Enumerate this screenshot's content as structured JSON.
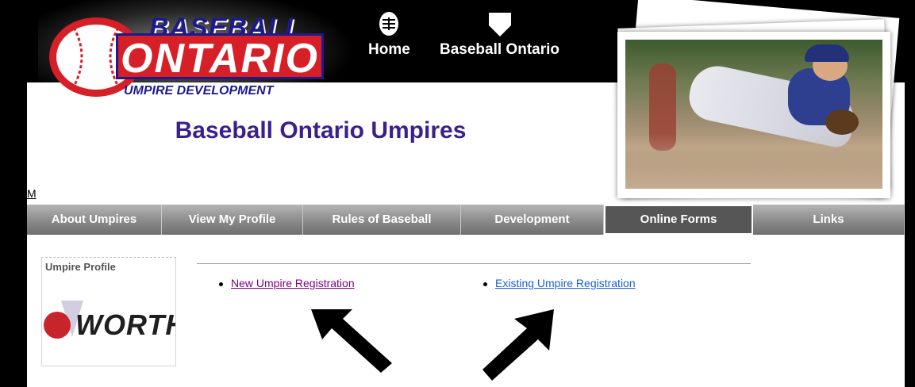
{
  "logo": {
    "line1": "BASEBALL",
    "line2": "ONTARIO",
    "line3": "UMPIRE DEVELOPMENT"
  },
  "topnav": {
    "home_label": "Home",
    "baseball_ontario_label": "Baseball Ontario"
  },
  "site": {
    "title": "Baseball Ontario Umpires",
    "m_link": "M"
  },
  "navbar": {
    "items": [
      {
        "label": "About Umpires"
      },
      {
        "label": "View My Profile"
      },
      {
        "label": "Rules of Baseball"
      },
      {
        "label": "Development"
      },
      {
        "label": "Online Forms",
        "active": true
      },
      {
        "label": "Links"
      }
    ]
  },
  "sidebar": {
    "title": "Umpire Profile",
    "sponsor_logo_text": "WORTH"
  },
  "content": {
    "links": [
      {
        "label": "New Umpire Registration",
        "color": "#800080"
      },
      {
        "label": "Existing Umpire Registration",
        "color": "#1a5fd6"
      }
    ]
  },
  "colors": {
    "title_purple": "#3b1f8c",
    "logo_red": "#d61f26",
    "logo_blue": "#1d1a8c",
    "nav_gray": "#8a8a8a",
    "nav_active": "#565656"
  }
}
